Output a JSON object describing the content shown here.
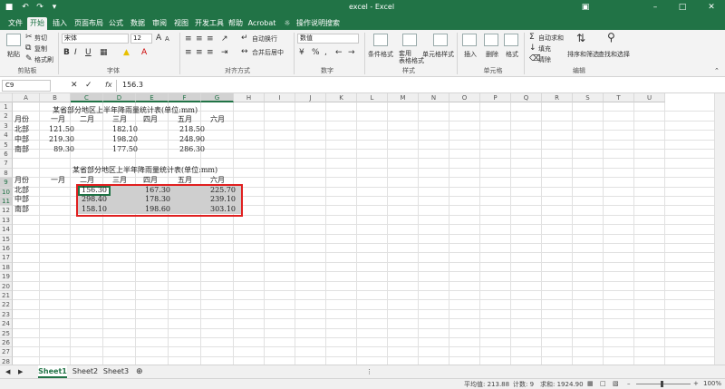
{
  "window": {
    "title": "excel - Excel"
  },
  "tabs": [
    "文件",
    "开始",
    "插入",
    "页面布局",
    "公式",
    "数据",
    "审阅",
    "视图",
    "开发工具",
    "帮助",
    "Acrobat"
  ],
  "active_tab": "开始",
  "tell_me": "操作说明搜索",
  "ribbon": {
    "clipboard": {
      "cut": "剪切",
      "copy": "复制",
      "format_painter": "格式刷",
      "paste": "粘贴",
      "label": "剪贴板"
    },
    "font": {
      "name": "宋体",
      "size": "12",
      "label": "字体"
    },
    "align": {
      "wrap": "自动换行",
      "merge": "合并后居中",
      "label": "对齐方式"
    },
    "number": {
      "format": "数值",
      "label": "数字"
    },
    "styles": {
      "cond": "条件格式",
      "table": "套用\n表格格式",
      "cell": "单元格样式",
      "label": "样式"
    },
    "cells": {
      "insert": "插入",
      "delete": "删除",
      "format": "格式",
      "label": "单元格"
    },
    "editing": {
      "autosum": "自动求和",
      "fill": "填充",
      "clear": "清除",
      "sort": "排序和筛选",
      "find": "查找和选择",
      "label": "编辑"
    }
  },
  "formula_bar": {
    "name_box": "C9",
    "fx": "fx",
    "value": "156.3"
  },
  "grid": {
    "columns": [
      "A",
      "B",
      "C",
      "D",
      "E",
      "F",
      "G",
      "H",
      "I",
      "J",
      "K",
      "L",
      "M",
      "N",
      "O",
      "P",
      "Q",
      "R",
      "S",
      "T",
      "U"
    ],
    "selected_columns": [
      "C",
      "D",
      "E",
      "F",
      "G"
    ],
    "rows": [
      "1",
      "2",
      "3",
      "4",
      "5",
      "6",
      "7",
      "8",
      "9",
      "10",
      "11",
      "12",
      "13",
      "14",
      "15",
      "16",
      "17",
      "18",
      "19",
      "20",
      "21",
      "22",
      "23",
      "24",
      "25",
      "26",
      "27",
      "28"
    ],
    "selected_rows": [
      "9",
      "10",
      "11"
    ]
  },
  "table1": {
    "title": "某省部分地区上半年降雨量统计表(单位:mm)",
    "headers": [
      "月份",
      "一月",
      "二月",
      "三月",
      "四月",
      "五月",
      "六月"
    ],
    "rows": [
      {
        "region": "北部",
        "jan": "121.50",
        "mar": "182.10",
        "may": "218.50"
      },
      {
        "region": "中部",
        "jan": "219.30",
        "mar": "198.20",
        "may": "248.90"
      },
      {
        "region": "南部",
        "jan": "89.30",
        "mar": "177.50",
        "may": "286.30"
      }
    ]
  },
  "table2": {
    "title": "某省部分地区上半年降雨量统计表(单位:mm)",
    "headers": [
      "月份",
      "一月",
      "二月",
      "三月",
      "四月",
      "五月",
      "六月"
    ],
    "rows": [
      {
        "region": "北部",
        "feb": "156.30",
        "apr": "167.30",
        "jun": "225.70"
      },
      {
        "region": "中部",
        "feb": "298.40",
        "apr": "178.30",
        "jun": "239.10"
      },
      {
        "region": "南部",
        "feb": "158.10",
        "apr": "198.60",
        "jun": "303.10"
      }
    ]
  },
  "sheets": [
    "Sheet1",
    "Sheet2",
    "Sheet3"
  ],
  "active_sheet": "Sheet1",
  "status": {
    "average": "平均值: 213.88",
    "count": "计数: 9",
    "sum": "求和: 1924.90",
    "zoom": "100%"
  }
}
